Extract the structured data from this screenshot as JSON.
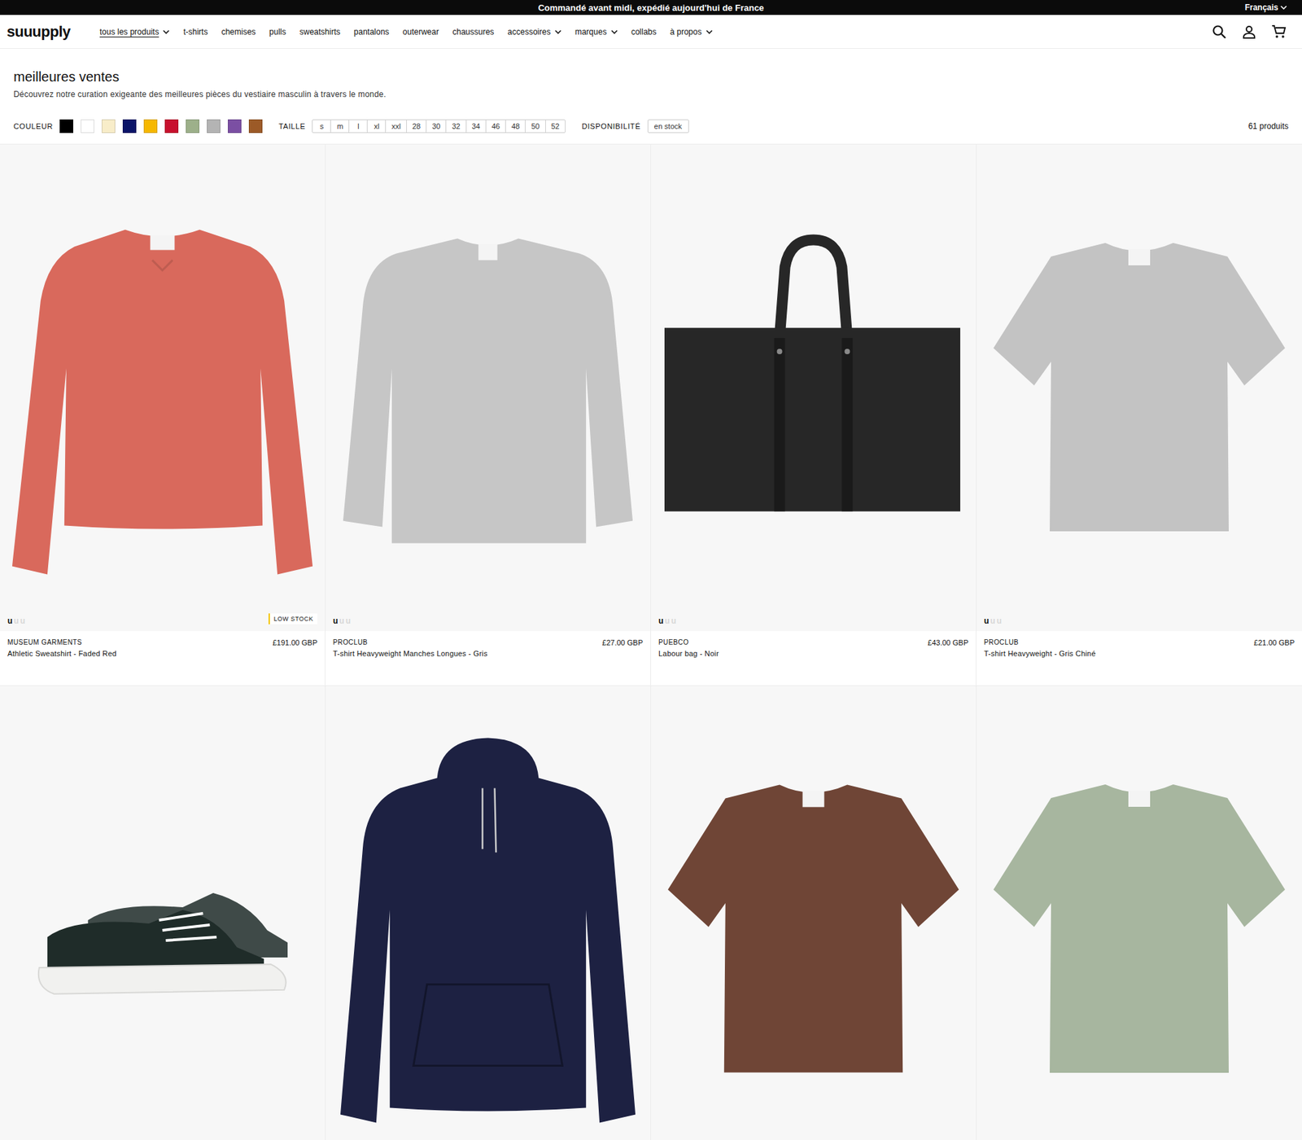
{
  "announcement": "Commandé avant midi, expédié aujourd'hui de France",
  "language": {
    "label": "Français",
    "expanded": false
  },
  "logo": "suuupply",
  "nav": [
    {
      "label": "tous les produits",
      "dropdown": true,
      "selected": true
    },
    {
      "label": "t-shirts",
      "dropdown": false,
      "selected": false
    },
    {
      "label": "chemises",
      "dropdown": false,
      "selected": false
    },
    {
      "label": "pulls",
      "dropdown": false,
      "selected": false
    },
    {
      "label": "sweatshirts",
      "dropdown": false,
      "selected": false
    },
    {
      "label": "pantalons",
      "dropdown": false,
      "selected": false
    },
    {
      "label": "outerwear",
      "dropdown": false,
      "selected": false
    },
    {
      "label": "chaussures",
      "dropdown": false,
      "selected": false
    },
    {
      "label": "accessoires",
      "dropdown": true,
      "selected": false
    },
    {
      "label": "marques",
      "dropdown": true,
      "selected": false
    },
    {
      "label": "collabs",
      "dropdown": false,
      "selected": false
    },
    {
      "label": "à propos",
      "dropdown": true,
      "selected": false
    }
  ],
  "page": {
    "title": "meilleures ventes",
    "subtitle": "Découvrez notre curation exigeante des meilleures pièces du vestiaire masculin à travers le monde."
  },
  "filters": {
    "color_label": "COULEUR",
    "colors": [
      {
        "color": "#000000",
        "selected": false
      },
      {
        "color": "#ffffff",
        "selected": false
      },
      {
        "color": "#f8edc9",
        "selected": false
      },
      {
        "color": "#0a1468",
        "selected": false
      },
      {
        "color": "#f6b800",
        "selected": false
      },
      {
        "color": "#c8102e",
        "selected": false
      },
      {
        "color": "#9db08a",
        "selected": false
      },
      {
        "color": "#b4b4b4",
        "selected": false
      },
      {
        "color": "#7b4fa3",
        "selected": false
      },
      {
        "color": "#9c5a27",
        "selected": false
      }
    ],
    "size_label": "TAILLE",
    "sizes": [
      {
        "label": "s",
        "selected": false
      },
      {
        "label": "m",
        "selected": false
      },
      {
        "label": "l",
        "selected": false
      },
      {
        "label": "xl",
        "selected": false
      },
      {
        "label": "xxl",
        "selected": false
      },
      {
        "label": "28",
        "selected": false
      },
      {
        "label": "30",
        "selected": false
      },
      {
        "label": "32",
        "selected": false
      },
      {
        "label": "34",
        "selected": false
      },
      {
        "label": "46",
        "selected": false
      },
      {
        "label": "48",
        "selected": false
      },
      {
        "label": "50",
        "selected": false
      },
      {
        "label": "52",
        "selected": false
      }
    ],
    "availability_label": "DISPONIBILITÉ",
    "availability": [
      {
        "label": "en stock",
        "selected": false
      }
    ],
    "count": "61 produits"
  },
  "products": [
    {
      "kind": "sweatshirt",
      "color": "#d9695c",
      "brand": "MUSEUM GARMENTS",
      "name": "Athletic Sweatshirt - Faded Red",
      "price": "£191.00 GBP",
      "badge": "LOW STOCK",
      "gallery": [
        {
          "label": "u",
          "selected": true
        },
        {
          "label": "u",
          "selected": false
        },
        {
          "label": "u",
          "selected": false
        }
      ]
    },
    {
      "kind": "longsleeve",
      "color": "#c6c6c6",
      "brand": "PROCLUB",
      "name": "T-shirt Heavyweight Manches Longues - Gris",
      "price": "£27.00 GBP",
      "badge": "",
      "gallery": [
        {
          "label": "u",
          "selected": true
        },
        {
          "label": "u",
          "selected": false
        },
        {
          "label": "u",
          "selected": false
        }
      ]
    },
    {
      "kind": "bag",
      "color": "#272727",
      "brand": "PUEBCO",
      "name": "Labour bag - Noir",
      "price": "£43.00 GBP",
      "badge": "",
      "gallery": [
        {
          "label": "u",
          "selected": true
        },
        {
          "label": "u",
          "selected": false
        },
        {
          "label": "u",
          "selected": false
        }
      ]
    },
    {
      "kind": "tshirt",
      "color": "#c3c3c3",
      "brand": "PROCLUB",
      "name": "T-shirt Heavyweight - Gris Chiné",
      "price": "£21.00 GBP",
      "badge": "",
      "gallery": [
        {
          "label": "u",
          "selected": true
        },
        {
          "label": "u",
          "selected": false
        },
        {
          "label": "u",
          "selected": false
        }
      ]
    },
    {
      "kind": "sneaker",
      "color": "#1f2c29",
      "brand": "",
      "name": "",
      "price": "",
      "badge": "",
      "gallery": []
    },
    {
      "kind": "hoodie",
      "color": "#1d2142",
      "brand": "",
      "name": "",
      "price": "",
      "badge": "",
      "gallery": []
    },
    {
      "kind": "tshirt",
      "color": "#6f4536",
      "brand": "",
      "name": "",
      "price": "",
      "badge": "",
      "gallery": []
    },
    {
      "kind": "tshirt",
      "color": "#a7b69f",
      "brand": "",
      "name": "",
      "price": "",
      "badge": "",
      "gallery": []
    }
  ]
}
